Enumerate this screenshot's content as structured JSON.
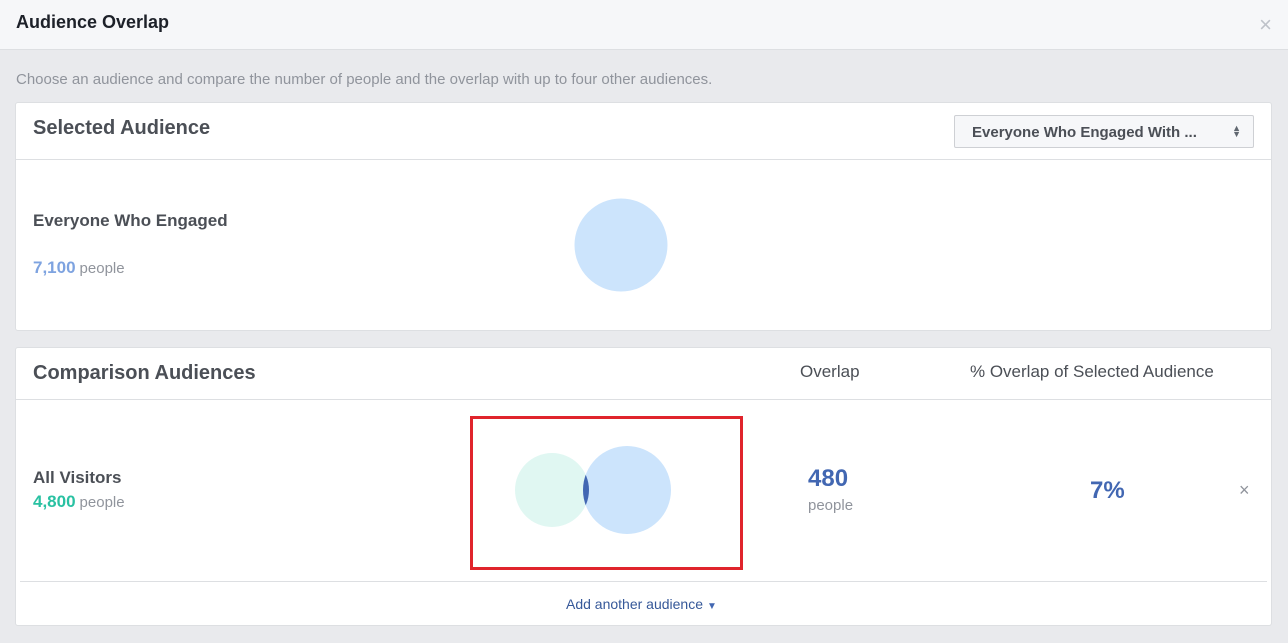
{
  "dialog": {
    "title": "Audience Overlap",
    "close_icon": "×",
    "intro": "Choose an audience and compare the number of people and the overlap with up to four other audiences."
  },
  "selected": {
    "section_title": "Selected Audience",
    "dropdown_value": "Everyone Who Engaged With ...",
    "dropdown_icon": "⬍",
    "audience_name": "Everyone Who Engaged",
    "count": "7,100",
    "count_label": "people",
    "count_color": "#7ea3e0"
  },
  "comparison": {
    "section_title": "Comparison Audiences",
    "col_overlap": "Overlap",
    "col_percent": "% Overlap of Selected Audience",
    "rows": [
      {
        "name": "All Visitors",
        "count": "4,800",
        "count_label": "people",
        "count_color": "#29c1a2",
        "overlap": "480",
        "overlap_label": "people",
        "percent": "7%",
        "remove_icon": "×"
      }
    ],
    "add_link": "Add another audience",
    "add_caret": "▼"
  },
  "colors": {
    "selected_circle": "#cce4fc",
    "comparison_circle": "#e0f7f2",
    "overlap_lens": "#4267b2",
    "highlight": "#e0242c"
  }
}
